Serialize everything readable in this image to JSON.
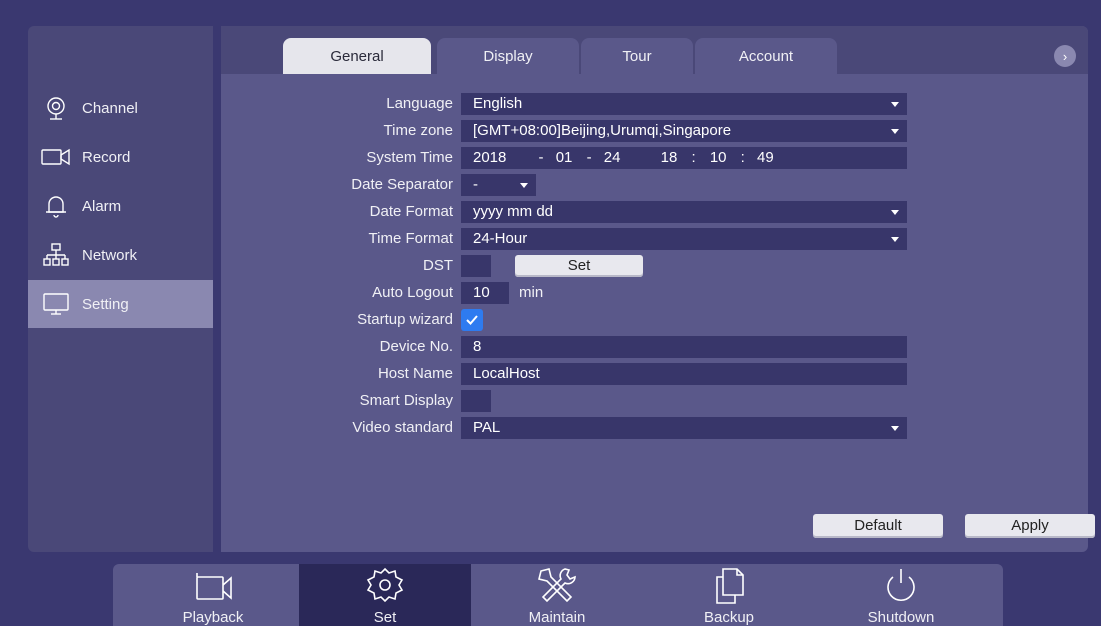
{
  "sidebar": {
    "items": [
      {
        "label": "Channel",
        "icon": "camera-icon"
      },
      {
        "label": "Record",
        "icon": "video-camera-icon"
      },
      {
        "label": "Alarm",
        "icon": "bell-icon"
      },
      {
        "label": "Network",
        "icon": "network-icon"
      },
      {
        "label": "Setting",
        "icon": "monitor-icon",
        "active": true
      }
    ]
  },
  "tabs": [
    {
      "label": "General",
      "active": true
    },
    {
      "label": "Display"
    },
    {
      "label": "Tour"
    },
    {
      "label": "Account"
    }
  ],
  "form": {
    "language": {
      "label": "Language",
      "value": "English"
    },
    "timezone": {
      "label": "Time zone",
      "value": "[GMT+08:00]Beijing,Urumqi,Singapore"
    },
    "system_time": {
      "label": "System Time",
      "year": "2018",
      "month": "01",
      "day": "24",
      "hour": "18",
      "minute": "10",
      "second": "49",
      "sep": "-",
      "colon": ":"
    },
    "date_separator": {
      "label": "Date Separator",
      "value": "-"
    },
    "date_format": {
      "label": "Date Format",
      "value": "yyyy mm dd"
    },
    "time_format": {
      "label": "Time Format",
      "value": "24-Hour"
    },
    "dst": {
      "label": "DST",
      "button": "Set"
    },
    "auto_logout": {
      "label": "Auto Logout",
      "value": "10",
      "unit": "min"
    },
    "startup_wizard": {
      "label": "Startup wizard",
      "checked": true
    },
    "device_no": {
      "label": "Device No.",
      "value": "8"
    },
    "host_name": {
      "label": "Host Name",
      "value": "LocalHost"
    },
    "smart_display": {
      "label": "Smart Display",
      "checked": false
    },
    "video_standard": {
      "label": "Video standard",
      "value": "PAL"
    }
  },
  "actions": {
    "default": "Default",
    "apply": "Apply"
  },
  "bottom": [
    {
      "label": "Playback",
      "icon": "video-camera-icon"
    },
    {
      "label": "Set",
      "icon": "gear-icon",
      "active": true
    },
    {
      "label": "Maintain",
      "icon": "tools-icon"
    },
    {
      "label": "Backup",
      "icon": "files-icon"
    },
    {
      "label": "Shutdown",
      "icon": "power-icon"
    }
  ],
  "colors": {
    "background": "#3a3870",
    "panel": "#5a588a",
    "field": "#38366a",
    "accent": "#2e7bf0"
  }
}
